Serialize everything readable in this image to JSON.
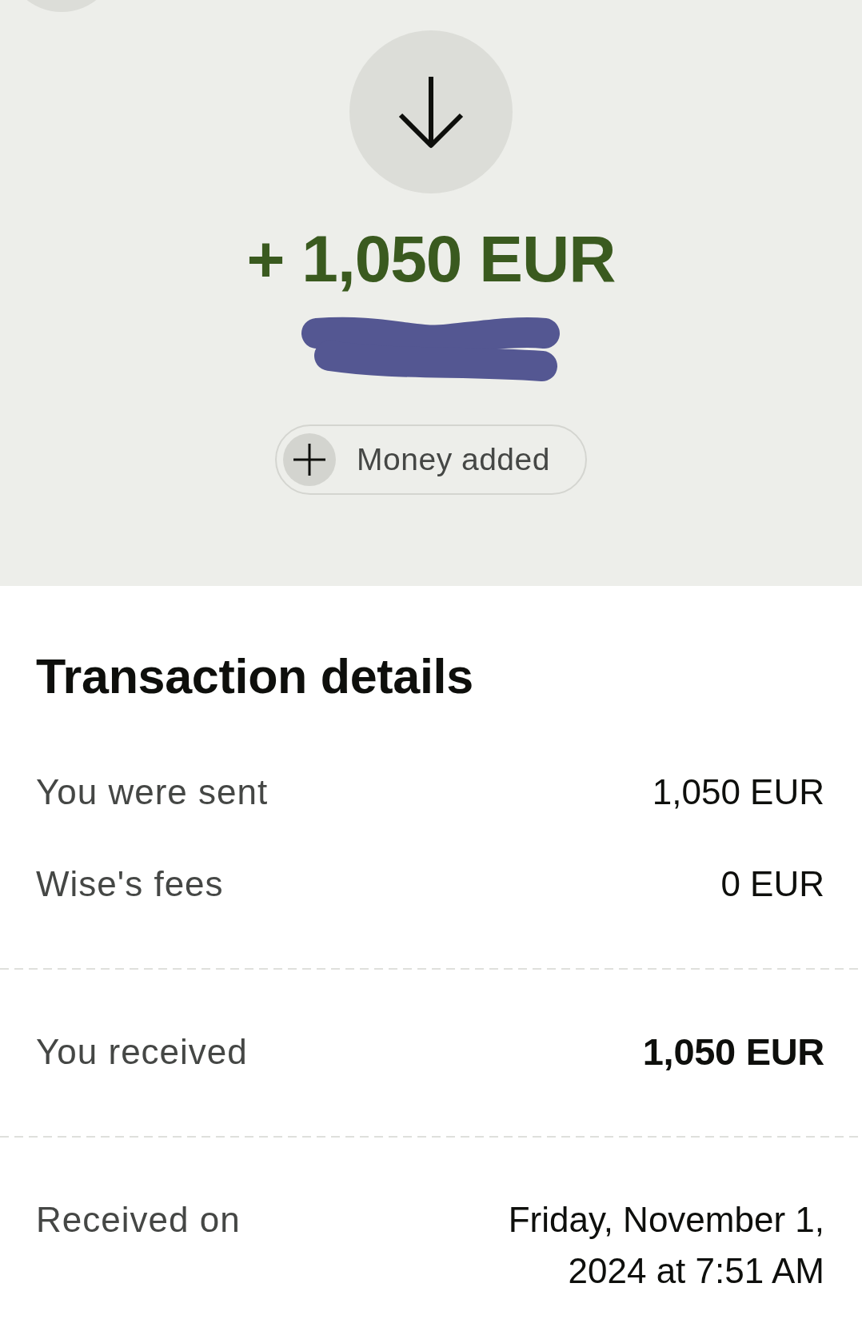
{
  "header": {
    "amount": "+ 1,050 EUR",
    "category": {
      "label": "Money added"
    }
  },
  "details": {
    "title": "Transaction details",
    "groups": [
      {
        "rows": [
          {
            "kind": "plain",
            "label": "You were sent",
            "value": "1,050 EUR"
          },
          {
            "kind": "plain",
            "label": "Wise's fees",
            "value": "0 EUR"
          }
        ]
      },
      {
        "rows": [
          {
            "kind": "total",
            "label": "You received",
            "value": "1,050 EUR"
          }
        ]
      },
      {
        "rows": [
          {
            "kind": "plain",
            "label": "Received on",
            "value": "Friday, November 1, 2024 at 7:51 AM"
          }
        ]
      }
    ]
  }
}
